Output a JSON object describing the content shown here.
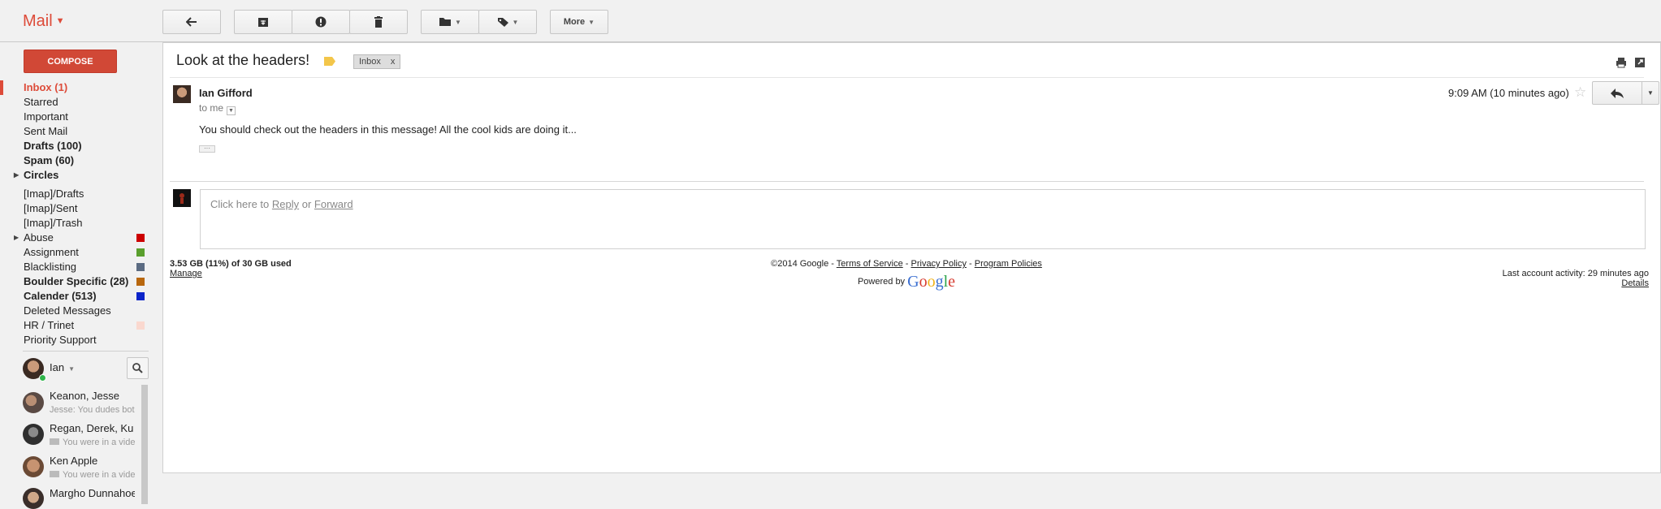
{
  "topbar": {
    "app_menu": "Mail",
    "more_label": "More",
    "icons": [
      "reply-icon",
      "archive-icon",
      "report-spam-icon",
      "delete-icon",
      "folder-icon",
      "tag-icon"
    ]
  },
  "nav": {
    "compose": "COMPOSE",
    "items": [
      {
        "label": "Inbox (1)"
      },
      {
        "label": "Starred"
      },
      {
        "label": "Important"
      },
      {
        "label": "Sent Mail"
      },
      {
        "label": "Drafts (100)"
      },
      {
        "label": "Spam (60)"
      },
      {
        "label": "Circles"
      },
      {
        "label": "[Imap]/Drafts"
      },
      {
        "label": "[Imap]/Sent"
      },
      {
        "label": "[Imap]/Trash"
      },
      {
        "label": "Abuse",
        "color": "#cc0000"
      },
      {
        "label": "Assignment",
        "color": "#5a9f2d"
      },
      {
        "label": "Blacklisting",
        "color": "#5b6b82"
      },
      {
        "label": "Boulder Specific (28)",
        "color": "#b8670e"
      },
      {
        "label": "Calender (513)",
        "color": "#0b24c9"
      },
      {
        "label": "Deleted Messages"
      },
      {
        "label": "HR / Trinet",
        "color": "#fad8cf"
      },
      {
        "label": "Priority Support"
      }
    ]
  },
  "chat": {
    "me": "Ian",
    "contacts": [
      {
        "name": "Keanon, Jesse",
        "preview": "Jesse: You dudes bot"
      },
      {
        "name": "Regan, Derek, Ku",
        "preview": "You were in a vide"
      },
      {
        "name": "Ken Apple",
        "preview": "You were in a vide"
      },
      {
        "name": "Margho Dunnahoe",
        "preview": ""
      }
    ]
  },
  "message": {
    "subject": "Look at the headers!",
    "label_chip": "Inbox",
    "chip_close": "x",
    "sender": "Ian Gifford",
    "to": "to me",
    "time": "9:09 AM (10 minutes ago)",
    "body": "You should check out the headers in this message! All the cool kids are doing it...",
    "ellipsis": "···"
  },
  "reply": {
    "prefix": "Click here to ",
    "reply_link": "Reply",
    "or": " or ",
    "forward_link": "Forward"
  },
  "footer": {
    "storage": "3.53 GB (11%) of 30 GB used",
    "manage": "Manage",
    "copyright": "©2014 Google - ",
    "terms": "Terms of Service",
    "sep": " - ",
    "privacy": "Privacy Policy",
    "program": "Program Policies",
    "powered_by": "Powered by ",
    "google": "Google",
    "activity": "Last account activity: 29 minutes ago",
    "details": "Details"
  }
}
